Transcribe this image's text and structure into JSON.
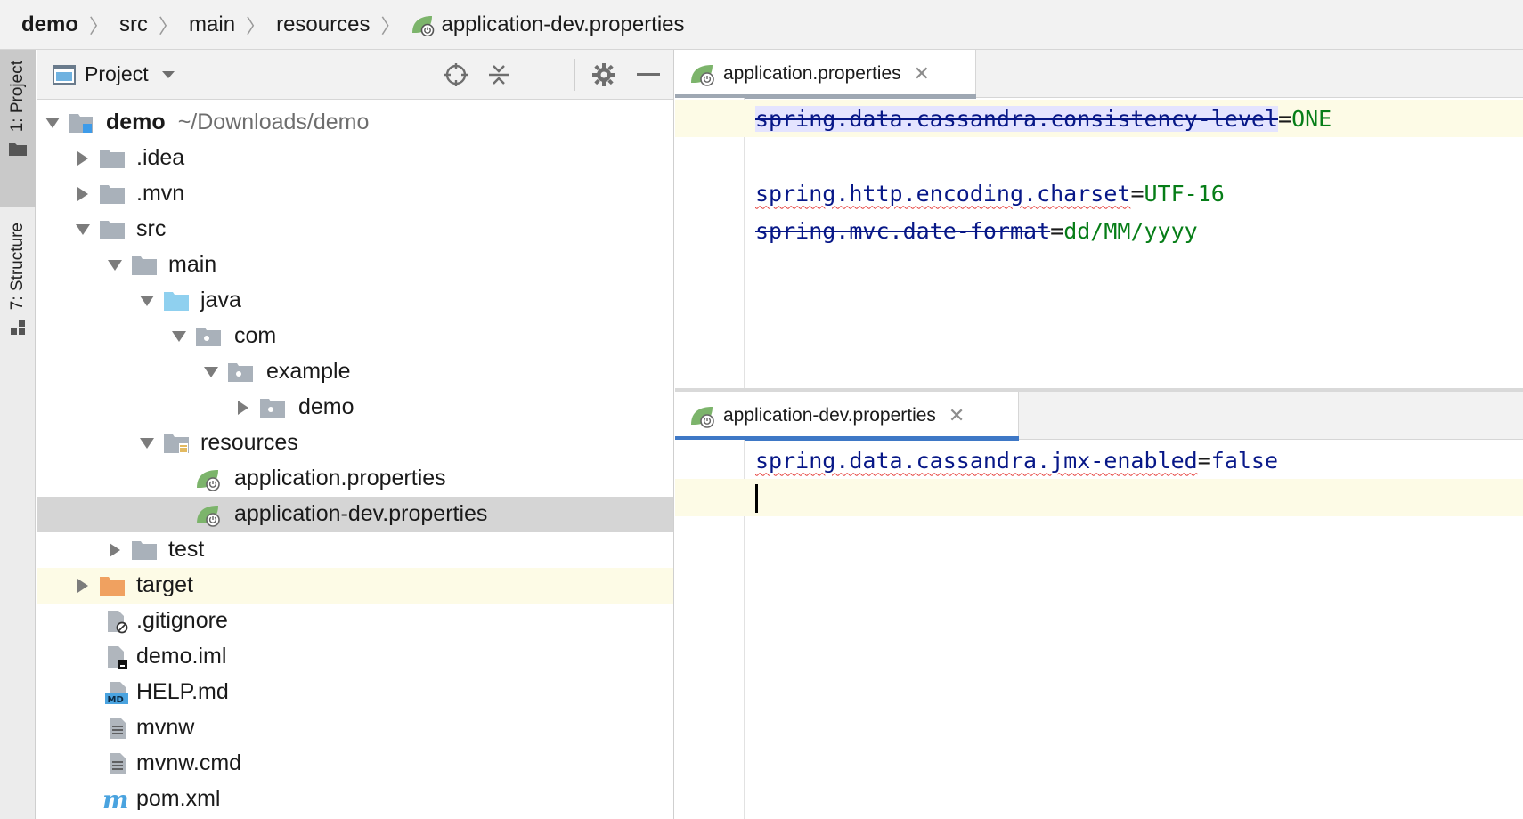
{
  "breadcrumb": [
    "demo",
    "src",
    "main",
    "resources",
    "application-dev.properties"
  ],
  "tool_strip": {
    "project_tab": "1: Project",
    "structure_tab": "7: Structure"
  },
  "project_panel": {
    "title": "Project",
    "tree": [
      {
        "label": "demo",
        "path": "~/Downloads/demo",
        "depth": 0,
        "expanded": true,
        "kind": "module-folder"
      },
      {
        "label": ".idea",
        "depth": 1,
        "expanded": false,
        "kind": "folder"
      },
      {
        "label": ".mvn",
        "depth": 1,
        "expanded": false,
        "kind": "folder"
      },
      {
        "label": "src",
        "depth": 1,
        "expanded": true,
        "kind": "folder"
      },
      {
        "label": "main",
        "depth": 2,
        "expanded": true,
        "kind": "folder"
      },
      {
        "label": "java",
        "depth": 3,
        "expanded": true,
        "kind": "source-folder"
      },
      {
        "label": "com",
        "depth": 4,
        "expanded": true,
        "kind": "package"
      },
      {
        "label": "example",
        "depth": 5,
        "expanded": true,
        "kind": "package"
      },
      {
        "label": "demo",
        "depth": 6,
        "expanded": false,
        "kind": "package"
      },
      {
        "label": "resources",
        "depth": 3,
        "expanded": true,
        "kind": "resources-folder"
      },
      {
        "label": "application.properties",
        "depth": 4,
        "kind": "spring-properties"
      },
      {
        "label": "application-dev.properties",
        "depth": 4,
        "kind": "spring-properties",
        "selected": true
      },
      {
        "label": "test",
        "depth": 2,
        "expanded": false,
        "kind": "folder"
      },
      {
        "label": "target",
        "depth": 1,
        "expanded": false,
        "kind": "excluded-folder"
      },
      {
        "label": ".gitignore",
        "depth": 1,
        "kind": "ignore-file"
      },
      {
        "label": "demo.iml",
        "depth": 1,
        "kind": "iml-file"
      },
      {
        "label": "HELP.md",
        "depth": 1,
        "kind": "markdown-file"
      },
      {
        "label": "mvnw",
        "depth": 1,
        "kind": "text-file"
      },
      {
        "label": "mvnw.cmd",
        "depth": 1,
        "kind": "text-file"
      },
      {
        "label": "pom.xml",
        "depth": 1,
        "kind": "maven-file"
      }
    ]
  },
  "editor_top": {
    "tab_label": "application.properties",
    "lines": [
      {
        "key": "spring.data.cassandra.consistency-level",
        "value": "ONE"
      },
      {
        "key": "",
        "value": ""
      },
      {
        "key": "spring.http.encoding.charset",
        "value": "UTF-16"
      },
      {
        "key": "spring.mvc.date-format",
        "value": "dd/MM/yyyy"
      }
    ]
  },
  "editor_bottom": {
    "tab_label": "application-dev.properties",
    "lines": [
      {
        "key": "spring.data.cassandra.jmx-enabled",
        "value": "false"
      },
      {
        "key": "",
        "value": ""
      }
    ]
  },
  "colors": {
    "property_key": "#071787",
    "property_value": "#067d17",
    "tab_accent_inactive": "#9fa8b3",
    "tab_accent_active": "#3e78c6",
    "selection_row": "#d5d5d5",
    "excluded_row": "#fdfbe6"
  }
}
